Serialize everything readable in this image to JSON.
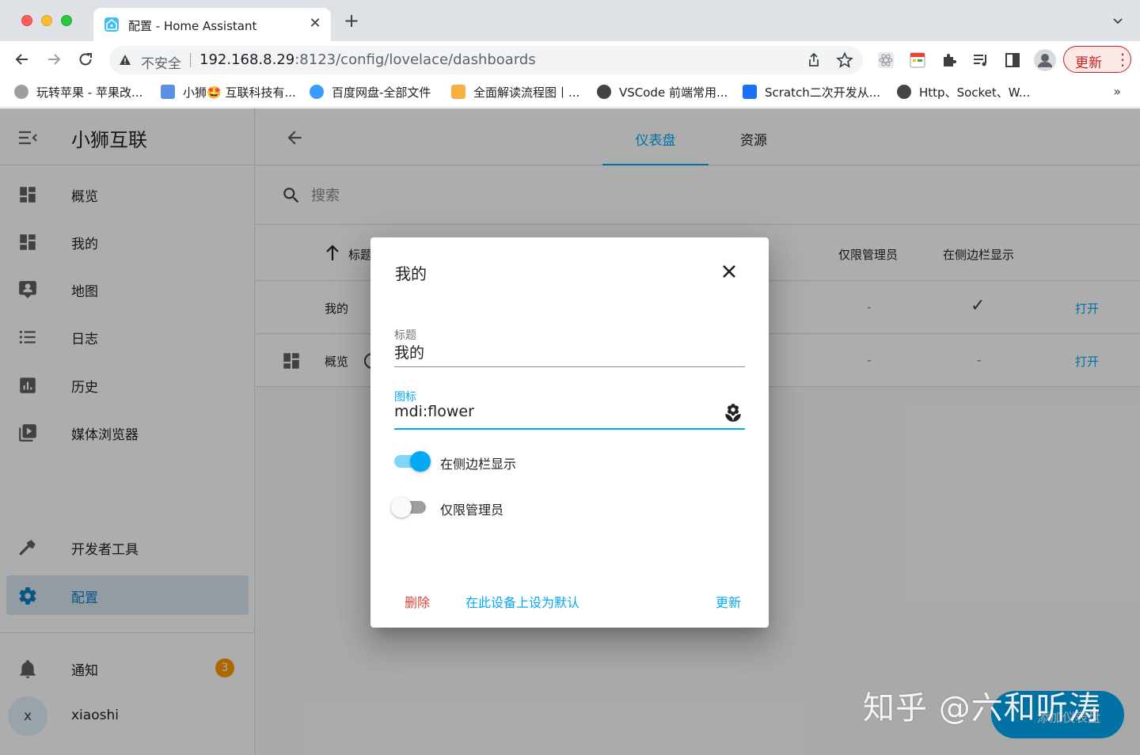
{
  "browser": {
    "tab_title": "配置 - Home Assistant",
    "new_tab_symbol": "+",
    "close_symbol": "✕",
    "omnibox": {
      "security_label": "不安全",
      "url_host": "192.168.8.29",
      "url_path": ":8123/config/lovelace/dashboards"
    },
    "update_label": "更新",
    "menu_symbol": "⋮",
    "bookmarks": [
      {
        "label": "玩转苹果 - 苹果改...",
        "color": "#9e9e9e"
      },
      {
        "label": "小狮🤩 互联科技有...",
        "color": "#5c8fe6"
      },
      {
        "label": "百度网盘-全部文件",
        "color": "#3b9cff"
      },
      {
        "label": "全面解读流程图丨...",
        "color": "#f6b042"
      },
      {
        "label": "VSCode 前端常用...",
        "color": "#444444"
      },
      {
        "label": "Scratch二次开发从...",
        "color": "#1772f6"
      },
      {
        "label": "Http、Socket、W...",
        "color": "#444444"
      }
    ],
    "bookmarks_more": "»"
  },
  "sidebar": {
    "title": "小狮互联",
    "items": [
      {
        "label": "概览",
        "icon": "view-dashboard-icon"
      },
      {
        "label": "我的",
        "icon": "view-dashboard-icon"
      },
      {
        "label": "地图",
        "icon": "account-box-icon"
      },
      {
        "label": "日志",
        "icon": "format-list-bulleted-icon"
      },
      {
        "label": "历史",
        "icon": "chart-box-icon"
      },
      {
        "label": "媒体浏览器",
        "icon": "play-box-multiple-icon"
      }
    ],
    "dev_tools_label": "开发者工具",
    "config_label": "配置",
    "notifications_label": "通知",
    "notifications_count": "3",
    "user_initial": "x",
    "user_name": "xiaoshi"
  },
  "header": {
    "tabs": [
      "仪表盘",
      "资源"
    ]
  },
  "search": {
    "placeholder": "搜索"
  },
  "table": {
    "columns": {
      "title": "标题",
      "require_admin": "仅限管理员",
      "show_in_sidebar": "在侧边栏显示"
    },
    "rows": [
      {
        "title": "我的",
        "require_admin": "-",
        "show_in_sidebar": "✓",
        "action": "打开"
      },
      {
        "title": "概览",
        "require_admin": "-",
        "show_in_sidebar": "-",
        "action": "打开"
      }
    ]
  },
  "fab_label": "添加仪表盘",
  "dialog": {
    "title": "我的",
    "title_field_label": "标题",
    "title_field_value": "我的",
    "icon_field_label": "图标",
    "icon_field_value": "mdi:flower",
    "show_in_sidebar_label": "在侧边栏显示",
    "show_in_sidebar": true,
    "require_admin_label": "仅限管理员",
    "require_admin": false,
    "delete_label": "删除",
    "set_default_label": "在此设备上设为默认",
    "update_label": "更新"
  },
  "colors": {
    "primary": "#03a9f4",
    "danger": "#db4437",
    "badge": "#ff9800"
  },
  "watermark": "知乎 @六和听涛"
}
